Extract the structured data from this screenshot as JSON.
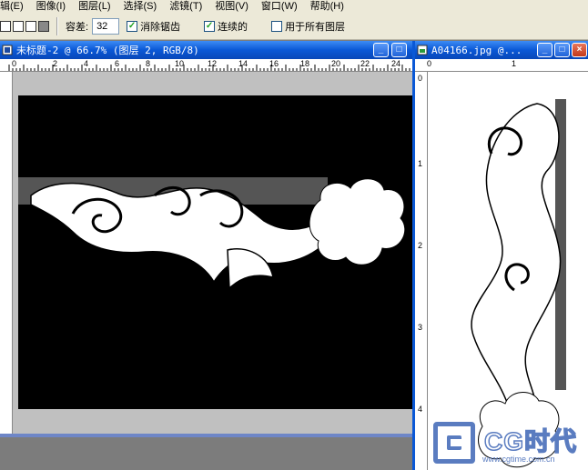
{
  "menubar": {
    "items": [
      "辑(E)",
      "图像(I)",
      "图层(L)",
      "选择(S)",
      "滤镜(T)",
      "视图(V)",
      "窗口(W)",
      "帮助(H)"
    ]
  },
  "options": {
    "tolerance_label": "容差:",
    "tolerance_value": "32",
    "antialias_label": "消除锯齿",
    "contiguous_label": "连续的",
    "all_layers_label": "用于所有图层",
    "antialias_checked": "✓",
    "contiguous_checked": "✓"
  },
  "doc1": {
    "title": "未标题-2 @ 66.7% (图层 2, RGB/8)",
    "ruler_h": [
      "0",
      "2",
      "4",
      "6",
      "8",
      "10",
      "12",
      "14",
      "16",
      "18",
      "20",
      "22",
      "24"
    ]
  },
  "doc2": {
    "title": "A04166.jpg @...",
    "ruler_h": [
      "0",
      "1"
    ],
    "ruler_v": [
      "0",
      "1",
      "2",
      "3",
      "4"
    ]
  },
  "watermark": {
    "brand": "CG时代",
    "url": "www.cgtime.com.cn"
  },
  "colors": {
    "titlebar": "#0a58d6",
    "workspace": "#7c7c7c",
    "chrome": "#ece9d8"
  }
}
